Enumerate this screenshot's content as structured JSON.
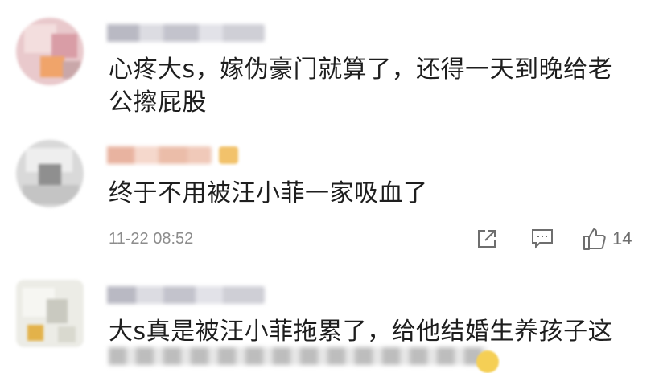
{
  "comments": [
    {
      "text_lines": [
        "心疼大s，嫁伪豪门就算了，还得一天到晚给老",
        "公擦屁股"
      ]
    },
    {
      "text_lines": [
        "终于不用被汪小菲一家吸血了"
      ],
      "timestamp": "11-22 08:52",
      "like_count": "14"
    },
    {
      "text_lines": [
        "大s真是被汪小菲拖累了，给他结婚生养孩子这"
      ]
    }
  ],
  "icons": {
    "share": "share-icon",
    "comment": "comment-icon",
    "like": "thumbs-up-icon"
  },
  "colors": {
    "text": "#1e1e1e",
    "meta": "#8c8c8c",
    "icon": "#6e6e6e"
  }
}
